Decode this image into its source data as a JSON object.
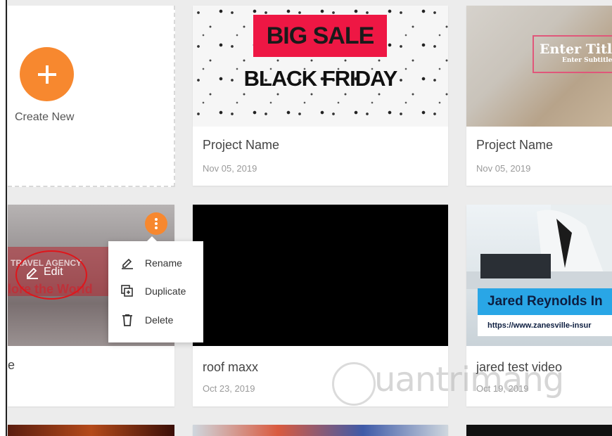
{
  "create": {
    "label": "Create New"
  },
  "projects": [
    {
      "title": "Project Name",
      "date": "Nov 05, 2019",
      "thumb": {
        "banner": "BIG SALE",
        "subtitle": "BLACK FRIDAY"
      }
    },
    {
      "title": "Project Name",
      "date": "Nov 05, 2019",
      "thumb": {
        "title": "Enter Title",
        "subtitle": "Enter Subtitle"
      }
    },
    {
      "title": "e",
      "thumb": {
        "brand": "TRAVEL AGENCY",
        "tagline": "lore the World"
      }
    },
    {
      "title": "roof maxx",
      "date": "Oct 23, 2019"
    },
    {
      "title": "jared test video",
      "date": "Oct 19, 2019",
      "thumb": {
        "name": "Jared Reynolds In",
        "url": "https://www.zanesville-insur"
      }
    }
  ],
  "edit": {
    "label": "Edit"
  },
  "context_menu": {
    "items": [
      {
        "label": "Rename",
        "icon": "pencil-icon"
      },
      {
        "label": "Duplicate",
        "icon": "duplicate-icon"
      },
      {
        "label": "Delete",
        "icon": "trash-icon"
      }
    ]
  },
  "watermark": "uantrimang",
  "colors": {
    "accent": "#f7882f",
    "sale_red": "#ee1744",
    "jared_blue": "#29a6e6"
  }
}
